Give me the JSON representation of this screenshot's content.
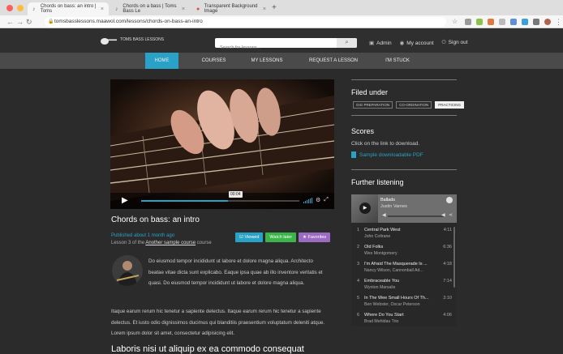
{
  "browser": {
    "tabs": [
      {
        "title": "Chords on bass: an intro | Toms",
        "active": true
      },
      {
        "title": "Chords on a bass | Toms Bass Le",
        "active": false
      },
      {
        "title": "Transparent Background Image",
        "active": false
      }
    ],
    "url": "tomsbasslessons.maawol.com/lessons/chords-on-bass-an-intro"
  },
  "header": {
    "logo_text": "TOMS BASS LESSONS",
    "search_placeholder": "Search for lessons...",
    "admin": "Admin",
    "account": "My account",
    "signout": "Sign out"
  },
  "nav": {
    "items": [
      "HOME",
      "COURSES",
      "MY LESSONS",
      "REQUEST A LESSON",
      "I'M STUCK"
    ]
  },
  "video": {
    "time": "00:04",
    "progress": 0.55
  },
  "lesson": {
    "title": "Chords on bass: an intro",
    "published": "Published about 1 month ago",
    "lesson_of_prefix": "Lesson 3 of the",
    "course_link": "Another sample course",
    "lesson_of_suffix": "course",
    "btn_viewed": "Viewed",
    "btn_watch_later": "Watch later",
    "btn_favorites": "Favorites",
    "para1": "Do eiusmod tempor incididunt ut labore et dolore magna aliqua. Architecto beatae vitae dicta sunt explicabo. Eaque ipsa quae ab illo inventore veritatis et quasi. Do eiusmod tempor incididunt ut labore et dolore magna aliqua.",
    "para2": "Itaque earum rerum hic tenetur a sapiente delectus. Itaque earum rerum hic tenetur a sapiente delectus. Et iusto odio dignissimos ducimus qui blanditiis praesentium voluptatum deleniti atque. Lorem ipsum dolor sit amet, consectetur adipisicing elit.",
    "heading2": "Laboris nisi ut aliquip ex ea commodo consequat"
  },
  "sidebar": {
    "filed_under": "Filed under",
    "tags": [
      "GIG PREPARATION",
      "CO-ORDINATION",
      "PRACTICING"
    ],
    "scores_title": "Scores",
    "scores_text": "Click on the link to download.",
    "pdf_link": "Sample downloadable PDF",
    "listening_title": "Further listening"
  },
  "spotify": {
    "playlist": "Ballads",
    "artist": "Justin Varnes",
    "tracks": [
      {
        "n": "1",
        "title": "Central Park West",
        "artist": "John Coltrane",
        "dur": "4:11"
      },
      {
        "n": "2",
        "title": "Old Folks",
        "artist": "Wes Montgomery",
        "dur": "6:36"
      },
      {
        "n": "3",
        "title": "I'm Afraid The Masquerade Is ...",
        "artist": "Nancy Wilson, Cannonball Ad...",
        "dur": "4:18"
      },
      {
        "n": "4",
        "title": "Embraceable You",
        "artist": "Wynton Marsalis",
        "dur": "7:14"
      },
      {
        "n": "5",
        "title": "In The Wee Small Hours Of Th...",
        "artist": "Ben Webster, Oscar Peterson",
        "dur": "3:10"
      },
      {
        "n": "6",
        "title": "Where Do You Start",
        "artist": "Brad Mehldau Trio",
        "dur": "4:06"
      }
    ]
  },
  "colors": {
    "accent": "#2aa1c7",
    "viewed": "#2aa1c7",
    "watch_later": "#3bb54a",
    "favorites": "#9b6bc4"
  }
}
